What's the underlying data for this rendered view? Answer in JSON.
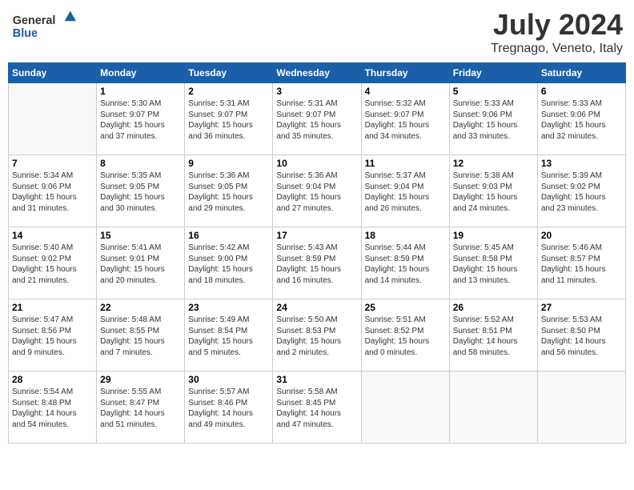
{
  "header": {
    "logo_general": "General",
    "logo_blue": "Blue",
    "month": "July 2024",
    "location": "Tregnago, Veneto, Italy"
  },
  "days_of_week": [
    "Sunday",
    "Monday",
    "Tuesday",
    "Wednesday",
    "Thursday",
    "Friday",
    "Saturday"
  ],
  "weeks": [
    [
      {
        "day": "",
        "info": ""
      },
      {
        "day": "1",
        "info": "Sunrise: 5:30 AM\nSunset: 9:07 PM\nDaylight: 15 hours\nand 37 minutes."
      },
      {
        "day": "2",
        "info": "Sunrise: 5:31 AM\nSunset: 9:07 PM\nDaylight: 15 hours\nand 36 minutes."
      },
      {
        "day": "3",
        "info": "Sunrise: 5:31 AM\nSunset: 9:07 PM\nDaylight: 15 hours\nand 35 minutes."
      },
      {
        "day": "4",
        "info": "Sunrise: 5:32 AM\nSunset: 9:07 PM\nDaylight: 15 hours\nand 34 minutes."
      },
      {
        "day": "5",
        "info": "Sunrise: 5:33 AM\nSunset: 9:06 PM\nDaylight: 15 hours\nand 33 minutes."
      },
      {
        "day": "6",
        "info": "Sunrise: 5:33 AM\nSunset: 9:06 PM\nDaylight: 15 hours\nand 32 minutes."
      }
    ],
    [
      {
        "day": "7",
        "info": "Sunrise: 5:34 AM\nSunset: 9:06 PM\nDaylight: 15 hours\nand 31 minutes."
      },
      {
        "day": "8",
        "info": "Sunrise: 5:35 AM\nSunset: 9:05 PM\nDaylight: 15 hours\nand 30 minutes."
      },
      {
        "day": "9",
        "info": "Sunrise: 5:36 AM\nSunset: 9:05 PM\nDaylight: 15 hours\nand 29 minutes."
      },
      {
        "day": "10",
        "info": "Sunrise: 5:36 AM\nSunset: 9:04 PM\nDaylight: 15 hours\nand 27 minutes."
      },
      {
        "day": "11",
        "info": "Sunrise: 5:37 AM\nSunset: 9:04 PM\nDaylight: 15 hours\nand 26 minutes."
      },
      {
        "day": "12",
        "info": "Sunrise: 5:38 AM\nSunset: 9:03 PM\nDaylight: 15 hours\nand 24 minutes."
      },
      {
        "day": "13",
        "info": "Sunrise: 5:39 AM\nSunset: 9:02 PM\nDaylight: 15 hours\nand 23 minutes."
      }
    ],
    [
      {
        "day": "14",
        "info": "Sunrise: 5:40 AM\nSunset: 9:02 PM\nDaylight: 15 hours\nand 21 minutes."
      },
      {
        "day": "15",
        "info": "Sunrise: 5:41 AM\nSunset: 9:01 PM\nDaylight: 15 hours\nand 20 minutes."
      },
      {
        "day": "16",
        "info": "Sunrise: 5:42 AM\nSunset: 9:00 PM\nDaylight: 15 hours\nand 18 minutes."
      },
      {
        "day": "17",
        "info": "Sunrise: 5:43 AM\nSunset: 8:59 PM\nDaylight: 15 hours\nand 16 minutes."
      },
      {
        "day": "18",
        "info": "Sunrise: 5:44 AM\nSunset: 8:59 PM\nDaylight: 15 hours\nand 14 minutes."
      },
      {
        "day": "19",
        "info": "Sunrise: 5:45 AM\nSunset: 8:58 PM\nDaylight: 15 hours\nand 13 minutes."
      },
      {
        "day": "20",
        "info": "Sunrise: 5:46 AM\nSunset: 8:57 PM\nDaylight: 15 hours\nand 11 minutes."
      }
    ],
    [
      {
        "day": "21",
        "info": "Sunrise: 5:47 AM\nSunset: 8:56 PM\nDaylight: 15 hours\nand 9 minutes."
      },
      {
        "day": "22",
        "info": "Sunrise: 5:48 AM\nSunset: 8:55 PM\nDaylight: 15 hours\nand 7 minutes."
      },
      {
        "day": "23",
        "info": "Sunrise: 5:49 AM\nSunset: 8:54 PM\nDaylight: 15 hours\nand 5 minutes."
      },
      {
        "day": "24",
        "info": "Sunrise: 5:50 AM\nSunset: 8:53 PM\nDaylight: 15 hours\nand 2 minutes."
      },
      {
        "day": "25",
        "info": "Sunrise: 5:51 AM\nSunset: 8:52 PM\nDaylight: 15 hours\nand 0 minutes."
      },
      {
        "day": "26",
        "info": "Sunrise: 5:52 AM\nSunset: 8:51 PM\nDaylight: 14 hours\nand 58 minutes."
      },
      {
        "day": "27",
        "info": "Sunrise: 5:53 AM\nSunset: 8:50 PM\nDaylight: 14 hours\nand 56 minutes."
      }
    ],
    [
      {
        "day": "28",
        "info": "Sunrise: 5:54 AM\nSunset: 8:48 PM\nDaylight: 14 hours\nand 54 minutes."
      },
      {
        "day": "29",
        "info": "Sunrise: 5:55 AM\nSunset: 8:47 PM\nDaylight: 14 hours\nand 51 minutes."
      },
      {
        "day": "30",
        "info": "Sunrise: 5:57 AM\nSunset: 8:46 PM\nDaylight: 14 hours\nand 49 minutes."
      },
      {
        "day": "31",
        "info": "Sunrise: 5:58 AM\nSunset: 8:45 PM\nDaylight: 14 hours\nand 47 minutes."
      },
      {
        "day": "",
        "info": ""
      },
      {
        "day": "",
        "info": ""
      },
      {
        "day": "",
        "info": ""
      }
    ]
  ]
}
